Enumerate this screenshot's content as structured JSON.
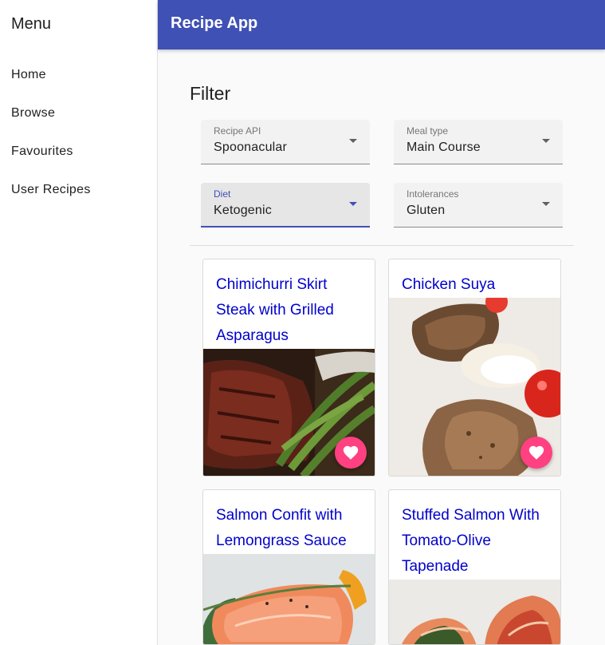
{
  "menu": {
    "title": "Menu",
    "items": [
      {
        "label": "Home"
      },
      {
        "label": "Browse"
      },
      {
        "label": "Favourites"
      },
      {
        "label": "User Recipes"
      }
    ]
  },
  "appbar": {
    "title": "Recipe App",
    "color": "#3f51b5"
  },
  "filter": {
    "heading": "Filter",
    "fields": [
      {
        "label": "Recipe API",
        "value": "Spoonacular"
      },
      {
        "label": "Meal type",
        "value": "Main Course"
      },
      {
        "label": "Diet",
        "value": "Ketogenic",
        "focused": true
      },
      {
        "label": "Intolerances",
        "value": "Gluten"
      }
    ]
  },
  "recipes": [
    {
      "title": "Chimichurri Skirt Steak with Grilled Asparagus",
      "image": "steak-asparagus-photo"
    },
    {
      "title": "Chicken Suya",
      "image": "chicken-tomato-photo"
    },
    {
      "title": "Salmon Confit with Lemongrass Sauce",
      "image": "salmon-photo"
    },
    {
      "title": "Stuffed Salmon With Tomato-Olive Tapenade",
      "image": "stuffed-salmon-photo"
    }
  ],
  "colors": {
    "accent": "#ff4081",
    "link": "#0000cc",
    "primary": "#3f51b5"
  },
  "icons": {
    "favourite": "heart-icon",
    "dropdown": "arrow-drop-down-icon"
  }
}
